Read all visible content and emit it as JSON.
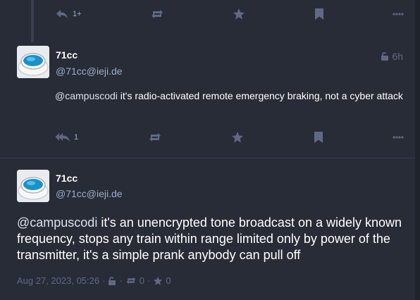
{
  "colors": {
    "background": "#282c37",
    "accent": "#8c8dff",
    "muted": "#606984",
    "secondary_text": "#9baec8"
  },
  "top_status": {
    "reply_count": "1+",
    "icons": [
      "reply-all-icon",
      "boost-icon",
      "star-icon",
      "bookmark-icon",
      "more-icon"
    ]
  },
  "reply_status": {
    "display_name": "71cc",
    "acct": "@71cc@ieji.de",
    "visibility_icon": "unlock-icon",
    "time": "6h",
    "mention": "@campuscodi",
    "content": " it's radio-activated remote emergency braking, not a cyber attack",
    "reply_count": "1",
    "icons": [
      "reply-all-icon",
      "boost-icon",
      "star-icon",
      "bookmark-icon",
      "more-icon"
    ]
  },
  "focused_status": {
    "display_name": "71cc",
    "acct": "@71cc@ieji.de",
    "mention": "@campuscodi",
    "content": " it's an unencrypted tone broadcast on a widely known frequency, stops any train within range limited only by power of the transmitter, it's a simple prank anybody can pull off",
    "timestamp": "Aug 27, 2023, 05:26",
    "separator": "·",
    "boost_count": "0",
    "favourite_count": "0"
  }
}
